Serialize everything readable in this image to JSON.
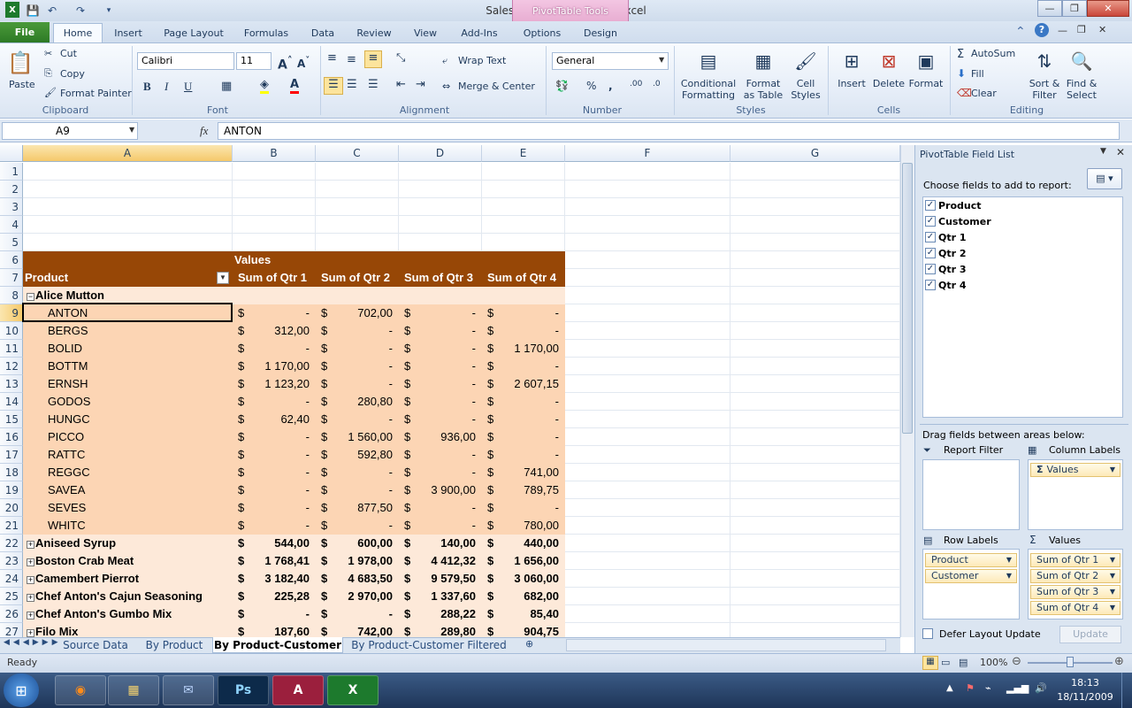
{
  "window": {
    "title": "SalesReport1 - Microsoft Excel",
    "context_tab_group": "PivotTable Tools"
  },
  "tabs": [
    "File",
    "Home",
    "Insert",
    "Page Layout",
    "Formulas",
    "Data",
    "Review",
    "View",
    "Add-Ins",
    "Options",
    "Design"
  ],
  "ribbon": {
    "clipboard": {
      "paste": "Paste",
      "cut": "Cut",
      "copy": "Copy",
      "format_painter": "Format Painter",
      "label": "Clipboard"
    },
    "font": {
      "name": "Calibri",
      "size": "11",
      "label": "Font"
    },
    "alignment": {
      "wrap_text": "Wrap Text",
      "merge_center": "Merge & Center",
      "label": "Alignment"
    },
    "number": {
      "format": "General",
      "label": "Number"
    },
    "styles": {
      "conditional": "Conditional",
      "conditional2": "Formatting",
      "format_as": "Format",
      "format_as2": "as Table",
      "cell": "Cell",
      "cell2": "Styles",
      "label": "Styles"
    },
    "cells": {
      "insert": "Insert",
      "delete": "Delete",
      "format": "Format",
      "label": "Cells"
    },
    "editing": {
      "autosum": "AutoSum",
      "fill": "Fill",
      "clear": "Clear",
      "sort": "Sort &",
      "sort2": "Filter",
      "find": "Find &",
      "find2": "Select",
      "label": "Editing"
    }
  },
  "formula_bar": {
    "name_box": "A9",
    "fx": "fx",
    "value": "ANTON"
  },
  "columns": [
    "A",
    "B",
    "C",
    "D",
    "E",
    "F",
    "G"
  ],
  "rows": [
    "1",
    "2",
    "3",
    "4",
    "5",
    "6",
    "7",
    "8",
    "9",
    "10",
    "11",
    "12",
    "13",
    "14",
    "15",
    "16",
    "17",
    "18",
    "19",
    "20",
    "21",
    "22",
    "23",
    "24",
    "25",
    "26",
    "27"
  ],
  "pivot": {
    "values_caption": "Values",
    "row_label": "Product",
    "headers": [
      "Sum of Qtr 1",
      "Sum of Qtr 2",
      "Sum of Qtr 3",
      "Sum of Qtr 4"
    ],
    "currency": "$",
    "expanded_product": "Alice Mutton",
    "customers": [
      {
        "name": "ANTON",
        "q": [
          "-",
          "702,00",
          "-",
          "-"
        ]
      },
      {
        "name": "BERGS",
        "q": [
          "312,00",
          "-",
          "-",
          "-"
        ]
      },
      {
        "name": "BOLID",
        "q": [
          "-",
          "-",
          "-",
          "1 170,00"
        ]
      },
      {
        "name": "BOTTM",
        "q": [
          "1 170,00",
          "-",
          "-",
          "-"
        ]
      },
      {
        "name": "ERNSH",
        "q": [
          "1 123,20",
          "-",
          "-",
          "2 607,15"
        ]
      },
      {
        "name": "GODOS",
        "q": [
          "-",
          "280,80",
          "-",
          "-"
        ]
      },
      {
        "name": "HUNGC",
        "q": [
          "62,40",
          "-",
          "-",
          "-"
        ]
      },
      {
        "name": "PICCO",
        "q": [
          "-",
          "1 560,00",
          "936,00",
          "-"
        ]
      },
      {
        "name": "RATTC",
        "q": [
          "-",
          "592,80",
          "-",
          "-"
        ]
      },
      {
        "name": "REGGC",
        "q": [
          "-",
          "-",
          "-",
          "741,00"
        ]
      },
      {
        "name": "SAVEA",
        "q": [
          "-",
          "-",
          "3 900,00",
          "789,75"
        ]
      },
      {
        "name": "SEVES",
        "q": [
          "-",
          "877,50",
          "-",
          "-"
        ]
      },
      {
        "name": "WHITC",
        "q": [
          "-",
          "-",
          "-",
          "780,00"
        ]
      }
    ],
    "products": [
      {
        "name": "Aniseed Syrup",
        "q": [
          "544,00",
          "600,00",
          "140,00",
          "440,00"
        ]
      },
      {
        "name": "Boston Crab Meat",
        "q": [
          "1 768,41",
          "1 978,00",
          "4 412,32",
          "1 656,00"
        ]
      },
      {
        "name": "Camembert Pierrot",
        "q": [
          "3 182,40",
          "4 683,50",
          "9 579,50",
          "3 060,00"
        ]
      },
      {
        "name": "Chef Anton's Cajun Seasoning",
        "q": [
          "225,28",
          "2 970,00",
          "1 337,60",
          "682,00"
        ]
      },
      {
        "name": "Chef Anton's Gumbo Mix",
        "q": [
          "-",
          "-",
          "288,22",
          "85,40"
        ]
      },
      {
        "name": "Filo Mix",
        "q": [
          "187,60",
          "742,00",
          "289,80",
          "904,75"
        ]
      }
    ]
  },
  "sheets": [
    "Source Data",
    "By Product",
    "By Product-Customer",
    "By Product-Customer Filtered"
  ],
  "active_sheet": "By Product-Customer",
  "field_list": {
    "title": "PivotTable Field List",
    "choose": "Choose fields to add to report:",
    "fields": [
      "Product",
      "Customer",
      "Qtr 1",
      "Qtr 2",
      "Qtr 3",
      "Qtr 4"
    ],
    "drag": "Drag fields between areas below:",
    "report_filter": "Report Filter",
    "column_labels": "Column Labels",
    "row_labels": "Row Labels",
    "values": "Values",
    "column_items": [
      "Values"
    ],
    "row_items": [
      "Product",
      "Customer"
    ],
    "value_items": [
      "Sum of Qtr 1",
      "Sum of Qtr 2",
      "Sum of Qtr 3",
      "Sum of Qtr 4"
    ],
    "defer": "Defer Layout Update",
    "update": "Update"
  },
  "status": {
    "ready": "Ready",
    "zoom": "100%"
  },
  "taskbar": {
    "time": "18:13",
    "date": "18/11/2009"
  }
}
